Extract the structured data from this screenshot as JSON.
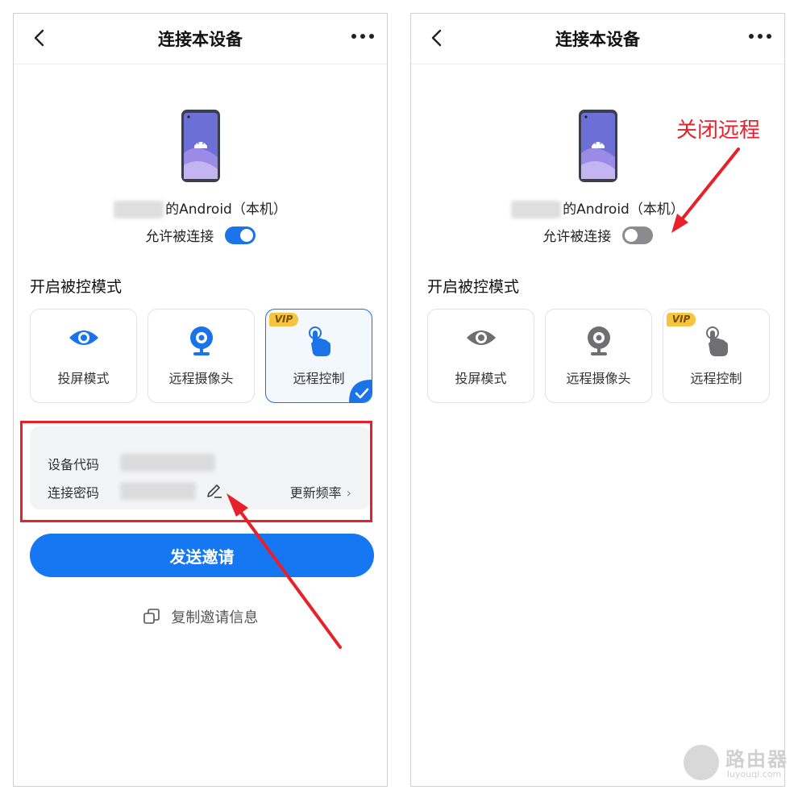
{
  "header": {
    "title": "连接本设备"
  },
  "device": {
    "name_suffix": "的Android（本机）",
    "allow_label": "允许被连接"
  },
  "left": {
    "allow_enabled": true
  },
  "right": {
    "allow_enabled": false
  },
  "section_title": "开启被控模式",
  "modes": [
    {
      "label": "投屏模式",
      "icon": "eye-icon"
    },
    {
      "label": "远程摄像头",
      "icon": "webcam-icon"
    },
    {
      "label": "远程控制",
      "icon": "touch-hand-icon",
      "vip": "VIP"
    }
  ],
  "selected_mode": "远程控制",
  "info": {
    "device_code_label": "设备代码",
    "password_label": "连接密码",
    "update_label": "更新频率"
  },
  "send_button": "发送邀请",
  "copy_link": "复制邀请信息",
  "annotation": {
    "right_label": "关闭远程"
  },
  "watermark": {
    "main": "路由器",
    "sub": "luyouqi.com"
  },
  "colors": {
    "accent": "#1677f2",
    "annotation_red": "#e8202a",
    "disabled_gray": "#6f6f73"
  }
}
